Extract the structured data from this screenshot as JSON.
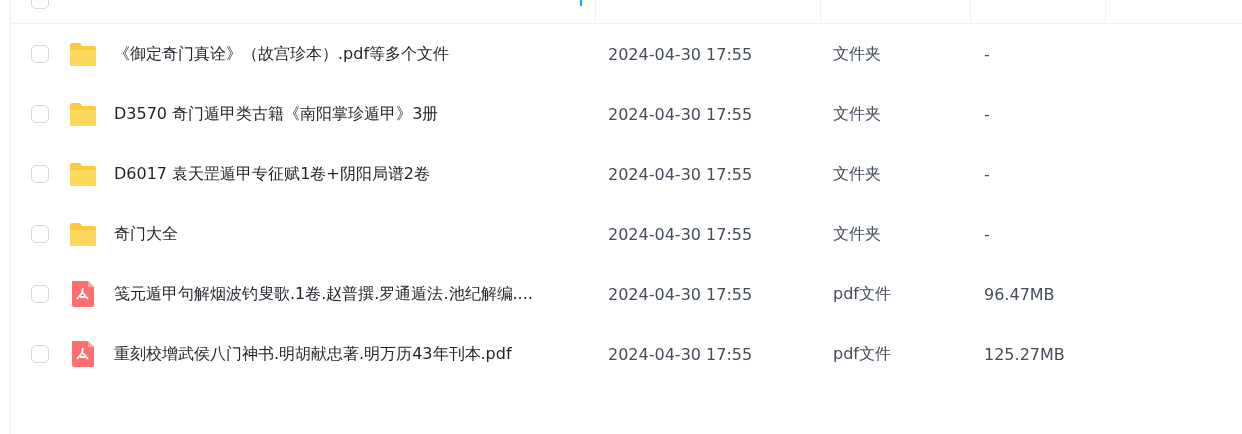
{
  "table": {
    "columns": [
      {
        "sorted": true
      },
      {
        "sorted": false
      },
      {
        "sorted": false
      },
      {
        "sorted": false
      }
    ],
    "select_all": {
      "checked": false
    },
    "rows": [
      {
        "kind": "folder",
        "name": "《御定奇门真诠》（故宫珍本）.pdf等多个文件",
        "modified": "2024-04-30 17:55",
        "type": "文件夹",
        "size": "-",
        "checked": false
      },
      {
        "kind": "folder",
        "name": "D3570 奇门遁甲类古籍《南阳掌珍遁甲》3册",
        "modified": "2024-04-30 17:55",
        "type": "文件夹",
        "size": "-",
        "checked": false
      },
      {
        "kind": "folder",
        "name": "D6017 袁天罡遁甲专征赋1卷+阴阳局谱2卷",
        "modified": "2024-04-30 17:55",
        "type": "文件夹",
        "size": "-",
        "checked": false
      },
      {
        "kind": "folder",
        "name": "奇门大全",
        "modified": "2024-04-30 17:55",
        "type": "文件夹",
        "size": "-",
        "checked": false
      },
      {
        "kind": "pdf",
        "name": "笺元遁甲句解烟波钓叟歌.1卷.赵普撰.罗通遁法.池纪解编....",
        "modified": "2024-04-30 17:55",
        "type": "pdf文件",
        "size": "96.47MB",
        "checked": false
      },
      {
        "kind": "pdf",
        "name": "重刻校增武侯八门神书.明胡献忠著.明万历43年刊本.pdf",
        "modified": "2024-04-30 17:55",
        "type": "pdf文件",
        "size": "125.27MB",
        "checked": false
      }
    ]
  }
}
